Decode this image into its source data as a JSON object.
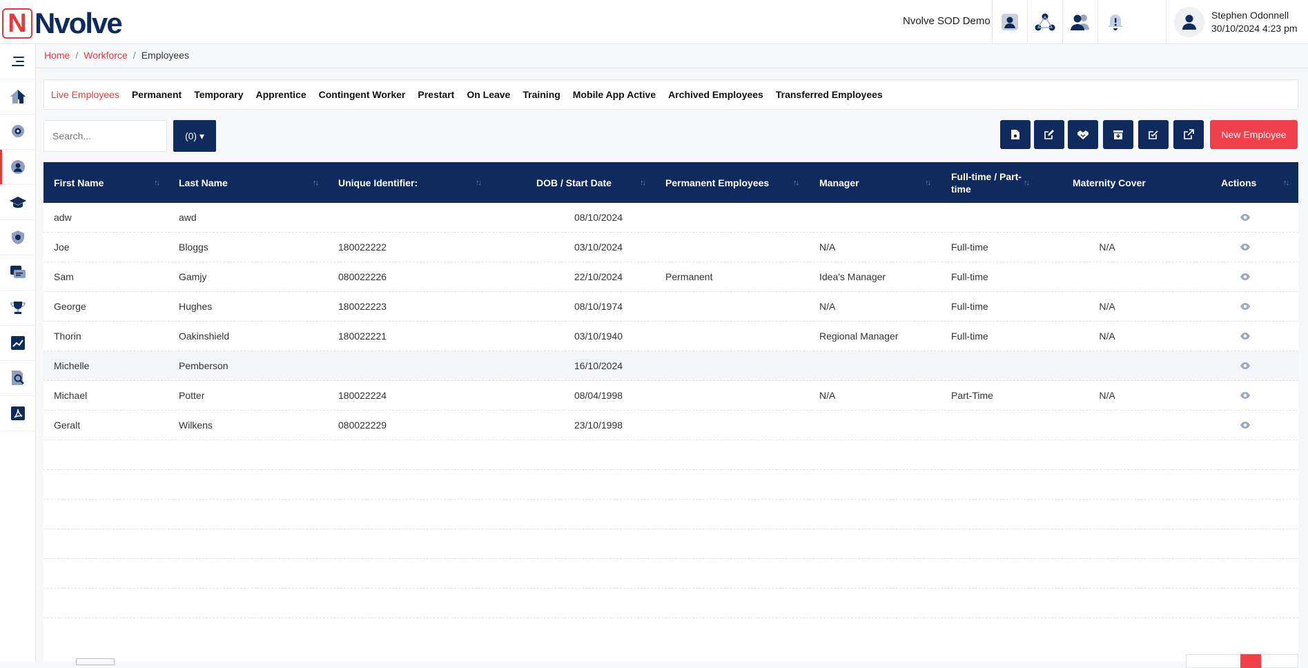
{
  "app": {
    "logo_letter": "N",
    "logo_name": "Nvolve",
    "org_name": "Nvolve SOD Demo"
  },
  "user": {
    "name": "Stephen Odonnell",
    "datetime": "30/10/2024 4:23 pm"
  },
  "breadcrumb": {
    "home": "Home",
    "workforce": "Workforce",
    "current": "Employees",
    "sep": "/"
  },
  "tabs": [
    {
      "label": "Live Employees",
      "active": true
    },
    {
      "label": "Permanent"
    },
    {
      "label": "Temporary"
    },
    {
      "label": "Apprentice"
    },
    {
      "label": "Contingent Worker"
    },
    {
      "label": "Prestart"
    },
    {
      "label": "On Leave"
    },
    {
      "label": "Training"
    },
    {
      "label": "Mobile App Active"
    },
    {
      "label": "Archived Employees"
    },
    {
      "label": "Transferred Employees"
    }
  ],
  "search": {
    "placeholder": "Search..."
  },
  "filter": {
    "label": "(0) ▾"
  },
  "toolbar": {
    "new_employee": "New Employee"
  },
  "table": {
    "columns": {
      "first": "First Name",
      "last": "Last Name",
      "uid": "Unique Identifier:",
      "dob": "DOB / Start Date",
      "perm": "Permanent Employees",
      "mgr": "Manager",
      "ft": "Full-time / Part-time",
      "mat": "Maternity Cover",
      "act": "Actions"
    },
    "rows": [
      {
        "first": "adw",
        "last": "awd",
        "uid": "",
        "dob": "08/10/2024",
        "perm": "",
        "mgr": "",
        "ft": "",
        "mat": ""
      },
      {
        "first": "Joe",
        "last": "Bloggs",
        "uid": "180022222",
        "dob": "03/10/2024",
        "perm": "",
        "mgr": "N/A",
        "ft": "Full-time",
        "mat": "N/A"
      },
      {
        "first": "Sam",
        "last": "Gamjy",
        "uid": "080022226",
        "dob": "22/10/2024",
        "perm": "Permanent",
        "mgr": "Idea's Manager",
        "ft": "Full-time",
        "mat": ""
      },
      {
        "first": "George",
        "last": "Hughes",
        "uid": "180022223",
        "dob": "08/10/1974",
        "perm": "",
        "mgr": "N/A",
        "ft": "Full-time",
        "mat": "N/A"
      },
      {
        "first": "Thorin",
        "last": "Oakinshield",
        "uid": "180022221",
        "dob": "03/10/1940",
        "perm": "",
        "mgr": "Regional Manager",
        "ft": "Full-time",
        "mat": "N/A"
      },
      {
        "first": "Michelle",
        "last": "Pemberson",
        "uid": "",
        "dob": "16/10/2024",
        "perm": "",
        "mgr": "",
        "ft": "",
        "mat": ""
      },
      {
        "first": "Michael",
        "last": "Potter",
        "uid": "180022224",
        "dob": "08/04/1998",
        "perm": "",
        "mgr": "N/A",
        "ft": "Part-Time",
        "mat": "N/A"
      },
      {
        "first": "Geralt",
        "last": "Wilkens",
        "uid": "080022229",
        "dob": "23/10/1998",
        "perm": "",
        "mgr": "",
        "ft": "",
        "mat": ""
      }
    ]
  }
}
